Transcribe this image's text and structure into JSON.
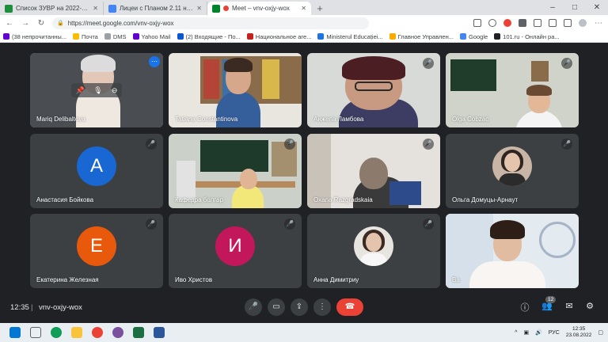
{
  "browser": {
    "tabs": [
      {
        "title": "Список ЗУВР на 2022-2023 уче",
        "favicon_color": "#4285f4",
        "active": false
      },
      {
        "title": "Лицеи с Планом 2.11 на 2022-",
        "favicon_color": "#4285f4",
        "active": false
      },
      {
        "title": "Meet – vnv-oxjy-wox",
        "favicon_color": "#00832d",
        "active": true
      }
    ],
    "new_tab": "+",
    "window_controls": [
      "–",
      "□",
      "✕"
    ],
    "url": "https://meet.google.com/vnv-oxjy-wox",
    "bookmarks": [
      {
        "label": "(38 непрочитанны...",
        "color": "#6001d2"
      },
      {
        "label": "Почта",
        "color": "#fbbc04"
      },
      {
        "label": "DMS",
        "color": "#9aa0a6"
      },
      {
        "label": "Yahoo Mail",
        "color": "#6001d2"
      },
      {
        "label": "(2) Входящие - По...",
        "color": "#0b57d0"
      },
      {
        "label": "Национальное аге...",
        "color": "#c5221f"
      },
      {
        "label": "Ministerul Educației...",
        "color": "#1a73e8"
      },
      {
        "label": "Главное Управлен...",
        "color": "#f9ab00"
      },
      {
        "label": "Google",
        "color": "#4285f4"
      },
      {
        "label": "101.ru - Онлайн ра...",
        "color": "#202124"
      }
    ]
  },
  "participants": [
    {
      "name": "Mariq Delibaltova",
      "type": "video",
      "active": true
    },
    {
      "name": "Tatiana Constantinova",
      "type": "video"
    },
    {
      "name": "Анжела Ламбова",
      "type": "video"
    },
    {
      "name": "Olga Cobzac",
      "type": "video"
    },
    {
      "name": "Анастасия Бойкова",
      "type": "avatar",
      "initial": "A",
      "color": "#1967d2"
    },
    {
      "name": "Кафедра болгар",
      "type": "video"
    },
    {
      "name": "Oxana Razgradskaia",
      "type": "video"
    },
    {
      "name": "Ольга Домуцы-Арнаут",
      "type": "photo"
    },
    {
      "name": "Екатерина Железная",
      "type": "avatar",
      "initial": "Е",
      "color": "#e8590c"
    },
    {
      "name": "Иво Христов",
      "type": "avatar",
      "initial": "И",
      "color": "#c2185b"
    },
    {
      "name": "Анна Димитриу",
      "type": "photo"
    },
    {
      "name": "Ва",
      "type": "video"
    }
  ],
  "footer": {
    "time": "12:35",
    "separator": "|",
    "meeting_code": "vnv-oxjy-wox",
    "participant_count": "12"
  },
  "taskbar": {
    "language": "РУС",
    "time": "12:35",
    "date": "23.08.2022"
  }
}
